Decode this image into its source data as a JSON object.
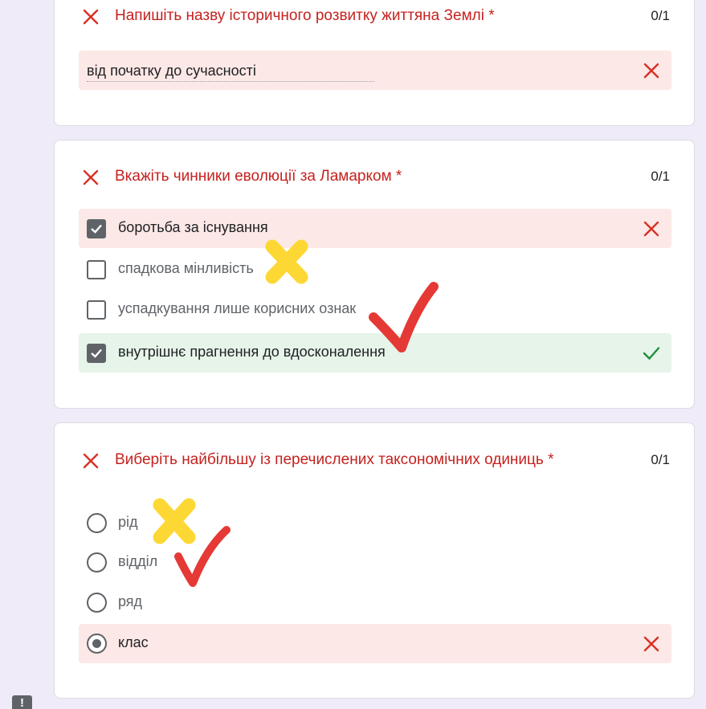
{
  "q1": {
    "title": "Напишіть назву історичного розвитку життяна Землі *",
    "score": "0/1",
    "answer": "від початку до сучасності"
  },
  "q2": {
    "title": "Вкажіть чинники еволюції за Ламарком *",
    "score": "0/1",
    "options": [
      {
        "label": "боротьба за існування",
        "checked": true,
        "result": "wrong"
      },
      {
        "label": "спадкова мінливість",
        "checked": false
      },
      {
        "label": "успадкування лише корисних ознак",
        "checked": false
      },
      {
        "label": "внутрішнє прагнення до вдосконалення",
        "checked": true,
        "result": "correct"
      }
    ]
  },
  "q3": {
    "title": "Виберіть найбільшу із перечислених таксономічних одиниць *",
    "score": "0/1",
    "options": [
      {
        "label": "рід",
        "selected": false
      },
      {
        "label": "відділ",
        "selected": false
      },
      {
        "label": "ряд",
        "selected": false
      },
      {
        "label": "клас",
        "selected": true,
        "result": "wrong"
      }
    ]
  },
  "feedback": {
    "glyph": "!"
  },
  "colors": {
    "background": "#f0ebf8",
    "wrong": "#c5221f",
    "wrong_bg": "#fce8e6",
    "correct": "#1e8e3e",
    "correct_bg": "#e6f4ea",
    "marker_yellow": "#fdd835",
    "marker_red": "#e53935"
  },
  "icons": [
    "wrong-x-icon",
    "correct-check-icon",
    "checkbox-icon",
    "radio-icon",
    "feedback-icon"
  ]
}
